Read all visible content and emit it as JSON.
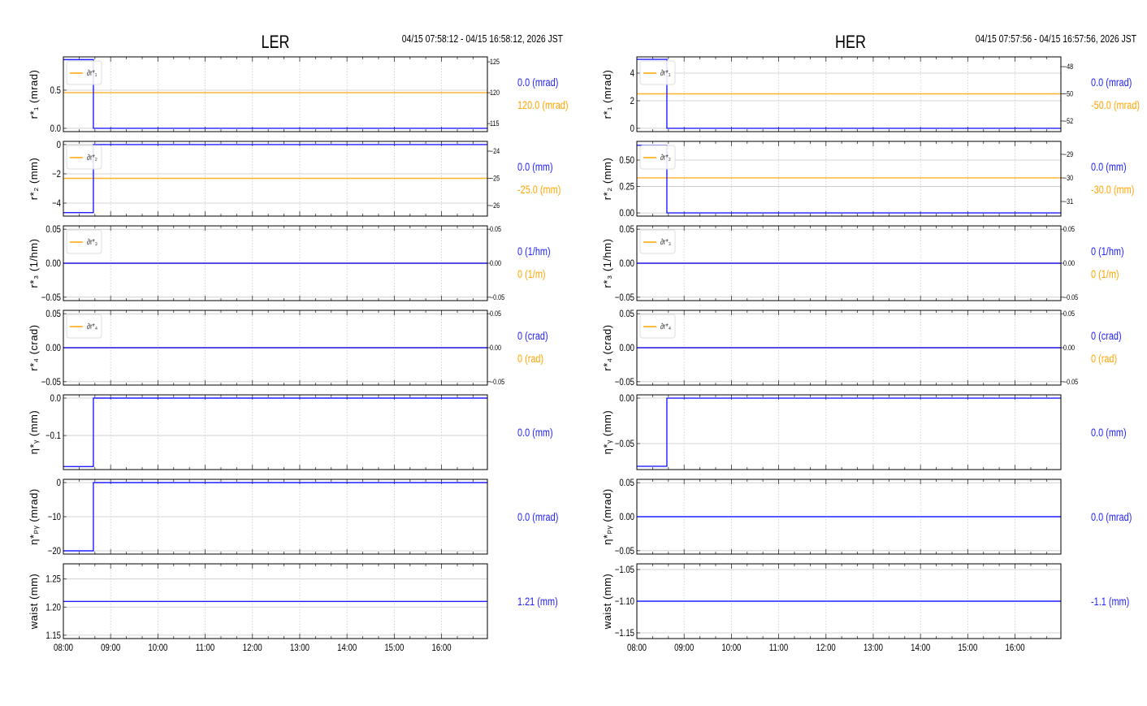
{
  "colors": {
    "primary": "#1f1fff",
    "reference": "#ffa500",
    "grid": "#c8c8c8",
    "frame": "#000000"
  },
  "chart_data": [
    {
      "type": "line",
      "title": "LER",
      "time_range": "04/15 07:58:12 - 04/15 16:58:12, 2026 JST",
      "x_unit": "hours after 08:00",
      "xlim": [
        0,
        8.97
      ],
      "xticks": [
        0,
        1,
        2,
        3,
        4,
        5,
        6,
        7,
        8
      ],
      "xtick_labels": [
        "08:00",
        "09:00",
        "10:00",
        "11:00",
        "12:00",
        "13:00",
        "14:00",
        "15:00",
        "16:00"
      ],
      "step_time": 0.635,
      "panels": [
        {
          "ylabel": "r*₁ (mrad)",
          "ylim": [
            -0.043,
            0.936
          ],
          "yticks": [
            0.0,
            0.5
          ],
          "ytick_labels": [
            "0.0",
            "0.5"
          ],
          "series": {
            "before": 0.9,
            "after": 0.0
          },
          "y2": {
            "ylim": [
              113.7,
              125.8
            ],
            "yticks": [
              115,
              120,
              125
            ],
            "ytick_labels": [
              "115",
              "120",
              "125"
            ],
            "value": 120
          },
          "legend": "∂r*₁",
          "value_label": "0.0 (mrad)",
          "ref_label": "120.0 (mrad)"
        },
        {
          "ylabel": "r*₂ (mm)",
          "ylim": [
            -4.89,
            0.22
          ],
          "yticks": [
            0,
            -2,
            -4
          ],
          "ytick_labels": [
            "0",
            "−2",
            "−4"
          ],
          "series": {
            "before": -4.65,
            "after": 0.0
          },
          "y2": {
            "ylim": [
              -26.39,
              -23.64
            ],
            "yticks": [
              -24,
              -25,
              -26
            ],
            "ytick_labels": [
              "−24",
              "−25",
              "−26"
            ],
            "value": -25
          },
          "legend": "∂r*₂",
          "value_label": "0.0 (mm)",
          "ref_label": "-25.0 (mm)"
        },
        {
          "ylabel": "r*₃ (1/hm)",
          "ylim": [
            -0.055,
            0.055
          ],
          "yticks": [
            0.05,
            0,
            -0.05
          ],
          "ytick_labels": [
            "0.05",
            "0.00",
            "−0.05"
          ],
          "series": {
            "before": 0,
            "after": 0
          },
          "y2": {
            "ylim": [
              -0.055,
              0.055
            ],
            "yticks": [
              0.05,
              0,
              -0.05
            ],
            "ytick_labels": [
              "0.05",
              "0.00",
              "−0.05"
            ],
            "value": 0
          },
          "legend": "∂r*₃",
          "value_label": "0 (1/hm)",
          "ref_label": "0 (1/m)"
        },
        {
          "ylabel": "r*₄ (crad)",
          "ylim": [
            -0.055,
            0.055
          ],
          "yticks": [
            0.05,
            0,
            -0.05
          ],
          "ytick_labels": [
            "0.05",
            "0.00",
            "−0.05"
          ],
          "series": {
            "before": 0,
            "after": 0
          },
          "y2": {
            "ylim": [
              -0.055,
              0.055
            ],
            "yticks": [
              0.05,
              0,
              -0.05
            ],
            "ytick_labels": [
              "0.05",
              "0.00",
              "−0.05"
            ],
            "value": 0
          },
          "legend": "∂r*₄",
          "value_label": "0 (crad)",
          "ref_label": "0 (rad)"
        },
        {
          "ylabel": "η*ᵧ (mm)",
          "ylim": [
            -0.191,
            0.0087
          ],
          "yticks": [
            0.0,
            -0.1
          ],
          "ytick_labels": [
            "0.0",
            "−0.1"
          ],
          "series": {
            "before": -0.183,
            "after": 0.0
          },
          "value_label": "0.0 (mm)"
        },
        {
          "ylabel": "η*ₚᵧ (mrad)",
          "ylim": [
            -20.95,
            0.95
          ],
          "yticks": [
            0,
            -10,
            -20
          ],
          "ytick_labels": [
            "0",
            "−10",
            "−20"
          ],
          "series": {
            "before": -20,
            "after": 0.0
          },
          "value_label": "0.0 (mrad)"
        },
        {
          "ylabel": "waist (mm)",
          "ylim": [
            1.144,
            1.277
          ],
          "yticks": [
            1.25,
            1.2,
            1.15
          ],
          "ytick_labels": [
            "1.25",
            "1.20",
            "1.15"
          ],
          "series": {
            "before": 1.21,
            "after": 1.21
          },
          "value_label": "1.21 (mm)"
        }
      ]
    },
    {
      "type": "line",
      "title": "HER",
      "time_range": "04/15 07:57:56 - 04/15 16:57:56, 2026 JST",
      "x_unit": "hours after 08:00",
      "xlim": [
        0,
        8.97
      ],
      "xticks": [
        0,
        1,
        2,
        3,
        4,
        5,
        6,
        7,
        8
      ],
      "xtick_labels": [
        "08:00",
        "09:00",
        "10:00",
        "11:00",
        "12:00",
        "13:00",
        "14:00",
        "15:00",
        "16:00"
      ],
      "step_time": 0.635,
      "panels": [
        {
          "ylabel": "r*₁ (mrad)",
          "ylim": [
            -0.24,
            5.18
          ],
          "yticks": [
            0,
            2,
            4
          ],
          "ytick_labels": [
            "0",
            "2",
            "4"
          ],
          "series": {
            "before": 5.0,
            "after": 0.0
          },
          "y2": {
            "ylim": [
              -52.78,
              -47.28
            ],
            "yticks": [
              -48,
              -50,
              -52
            ],
            "ytick_labels": [
              "−48",
              "−50",
              "−52"
            ],
            "value": -50
          },
          "legend": "∂r*₁",
          "value_label": "0.0 (mrad)",
          "ref_label": "-50.0 (mrad)"
        },
        {
          "ylabel": "r*₂ (mm)",
          "ylim": [
            -0.03,
            0.677
          ],
          "yticks": [
            0.5,
            0.25,
            0.0
          ],
          "ytick_labels": [
            "0.50",
            "0.25",
            "0.00"
          ],
          "series": {
            "before": 0.64,
            "after": 0.0
          },
          "y2": {
            "ylim": [
              -31.62,
              -28.45
            ],
            "yticks": [
              -29,
              -30,
              -31
            ],
            "ytick_labels": [
              "−29",
              "−30",
              "−31"
            ],
            "value": -30
          },
          "legend": "∂r*₂",
          "value_label": "0.0 (mm)",
          "ref_label": "-30.0 (mm)"
        },
        {
          "ylabel": "r*₃ (1/hm)",
          "ylim": [
            -0.055,
            0.055
          ],
          "yticks": [
            0.05,
            0,
            -0.05
          ],
          "ytick_labels": [
            "0.05",
            "0.00",
            "−0.05"
          ],
          "series": {
            "before": 0,
            "after": 0
          },
          "y2": {
            "ylim": [
              -0.055,
              0.055
            ],
            "yticks": [
              0.05,
              0,
              -0.05
            ],
            "ytick_labels": [
              "0.05",
              "0.00",
              "−0.05"
            ],
            "value": 0
          },
          "legend": "∂r*₃",
          "value_label": "0 (1/hm)",
          "ref_label": "0 (1/m)"
        },
        {
          "ylabel": "r*₄ (crad)",
          "ylim": [
            -0.055,
            0.055
          ],
          "yticks": [
            0.05,
            0,
            -0.05
          ],
          "ytick_labels": [
            "0.05",
            "0.00",
            "−0.05"
          ],
          "series": {
            "before": 0,
            "after": 0
          },
          "y2": {
            "ylim": [
              -0.055,
              0.055
            ],
            "yticks": [
              0.05,
              0,
              -0.05
            ],
            "ytick_labels": [
              "0.05",
              "0.00",
              "−0.05"
            ],
            "value": 0
          },
          "legend": "∂r*₄",
          "value_label": "0 (crad)",
          "ref_label": "0 (rad)"
        },
        {
          "ylabel": "η*ᵧ (mm)",
          "ylim": [
            -0.0786,
            0.0036
          ],
          "yticks": [
            0.0,
            -0.05
          ],
          "ytick_labels": [
            "0.00",
            "−0.05"
          ],
          "series": {
            "before": -0.075,
            "after": 0.0
          },
          "value_label": "0.0 (mm)"
        },
        {
          "ylabel": "η*ₚᵧ (mrad)",
          "ylim": [
            -0.055,
            0.055
          ],
          "yticks": [
            0.05,
            0,
            -0.05
          ],
          "ytick_labels": [
            "0.05",
            "0.00",
            "−0.05"
          ],
          "series": {
            "before": 0,
            "after": 0
          },
          "value_label": "0.0 (mrad)"
        },
        {
          "ylabel": "waist (mm)",
          "ylim": [
            -1.159,
            -1.041
          ],
          "yticks": [
            -1.05,
            -1.1,
            -1.15
          ],
          "ytick_labels": [
            "−1.05",
            "−1.10",
            "−1.15"
          ],
          "series": {
            "before": -1.1,
            "after": -1.1
          },
          "value_label": "-1.1 (mm)"
        }
      ]
    }
  ]
}
